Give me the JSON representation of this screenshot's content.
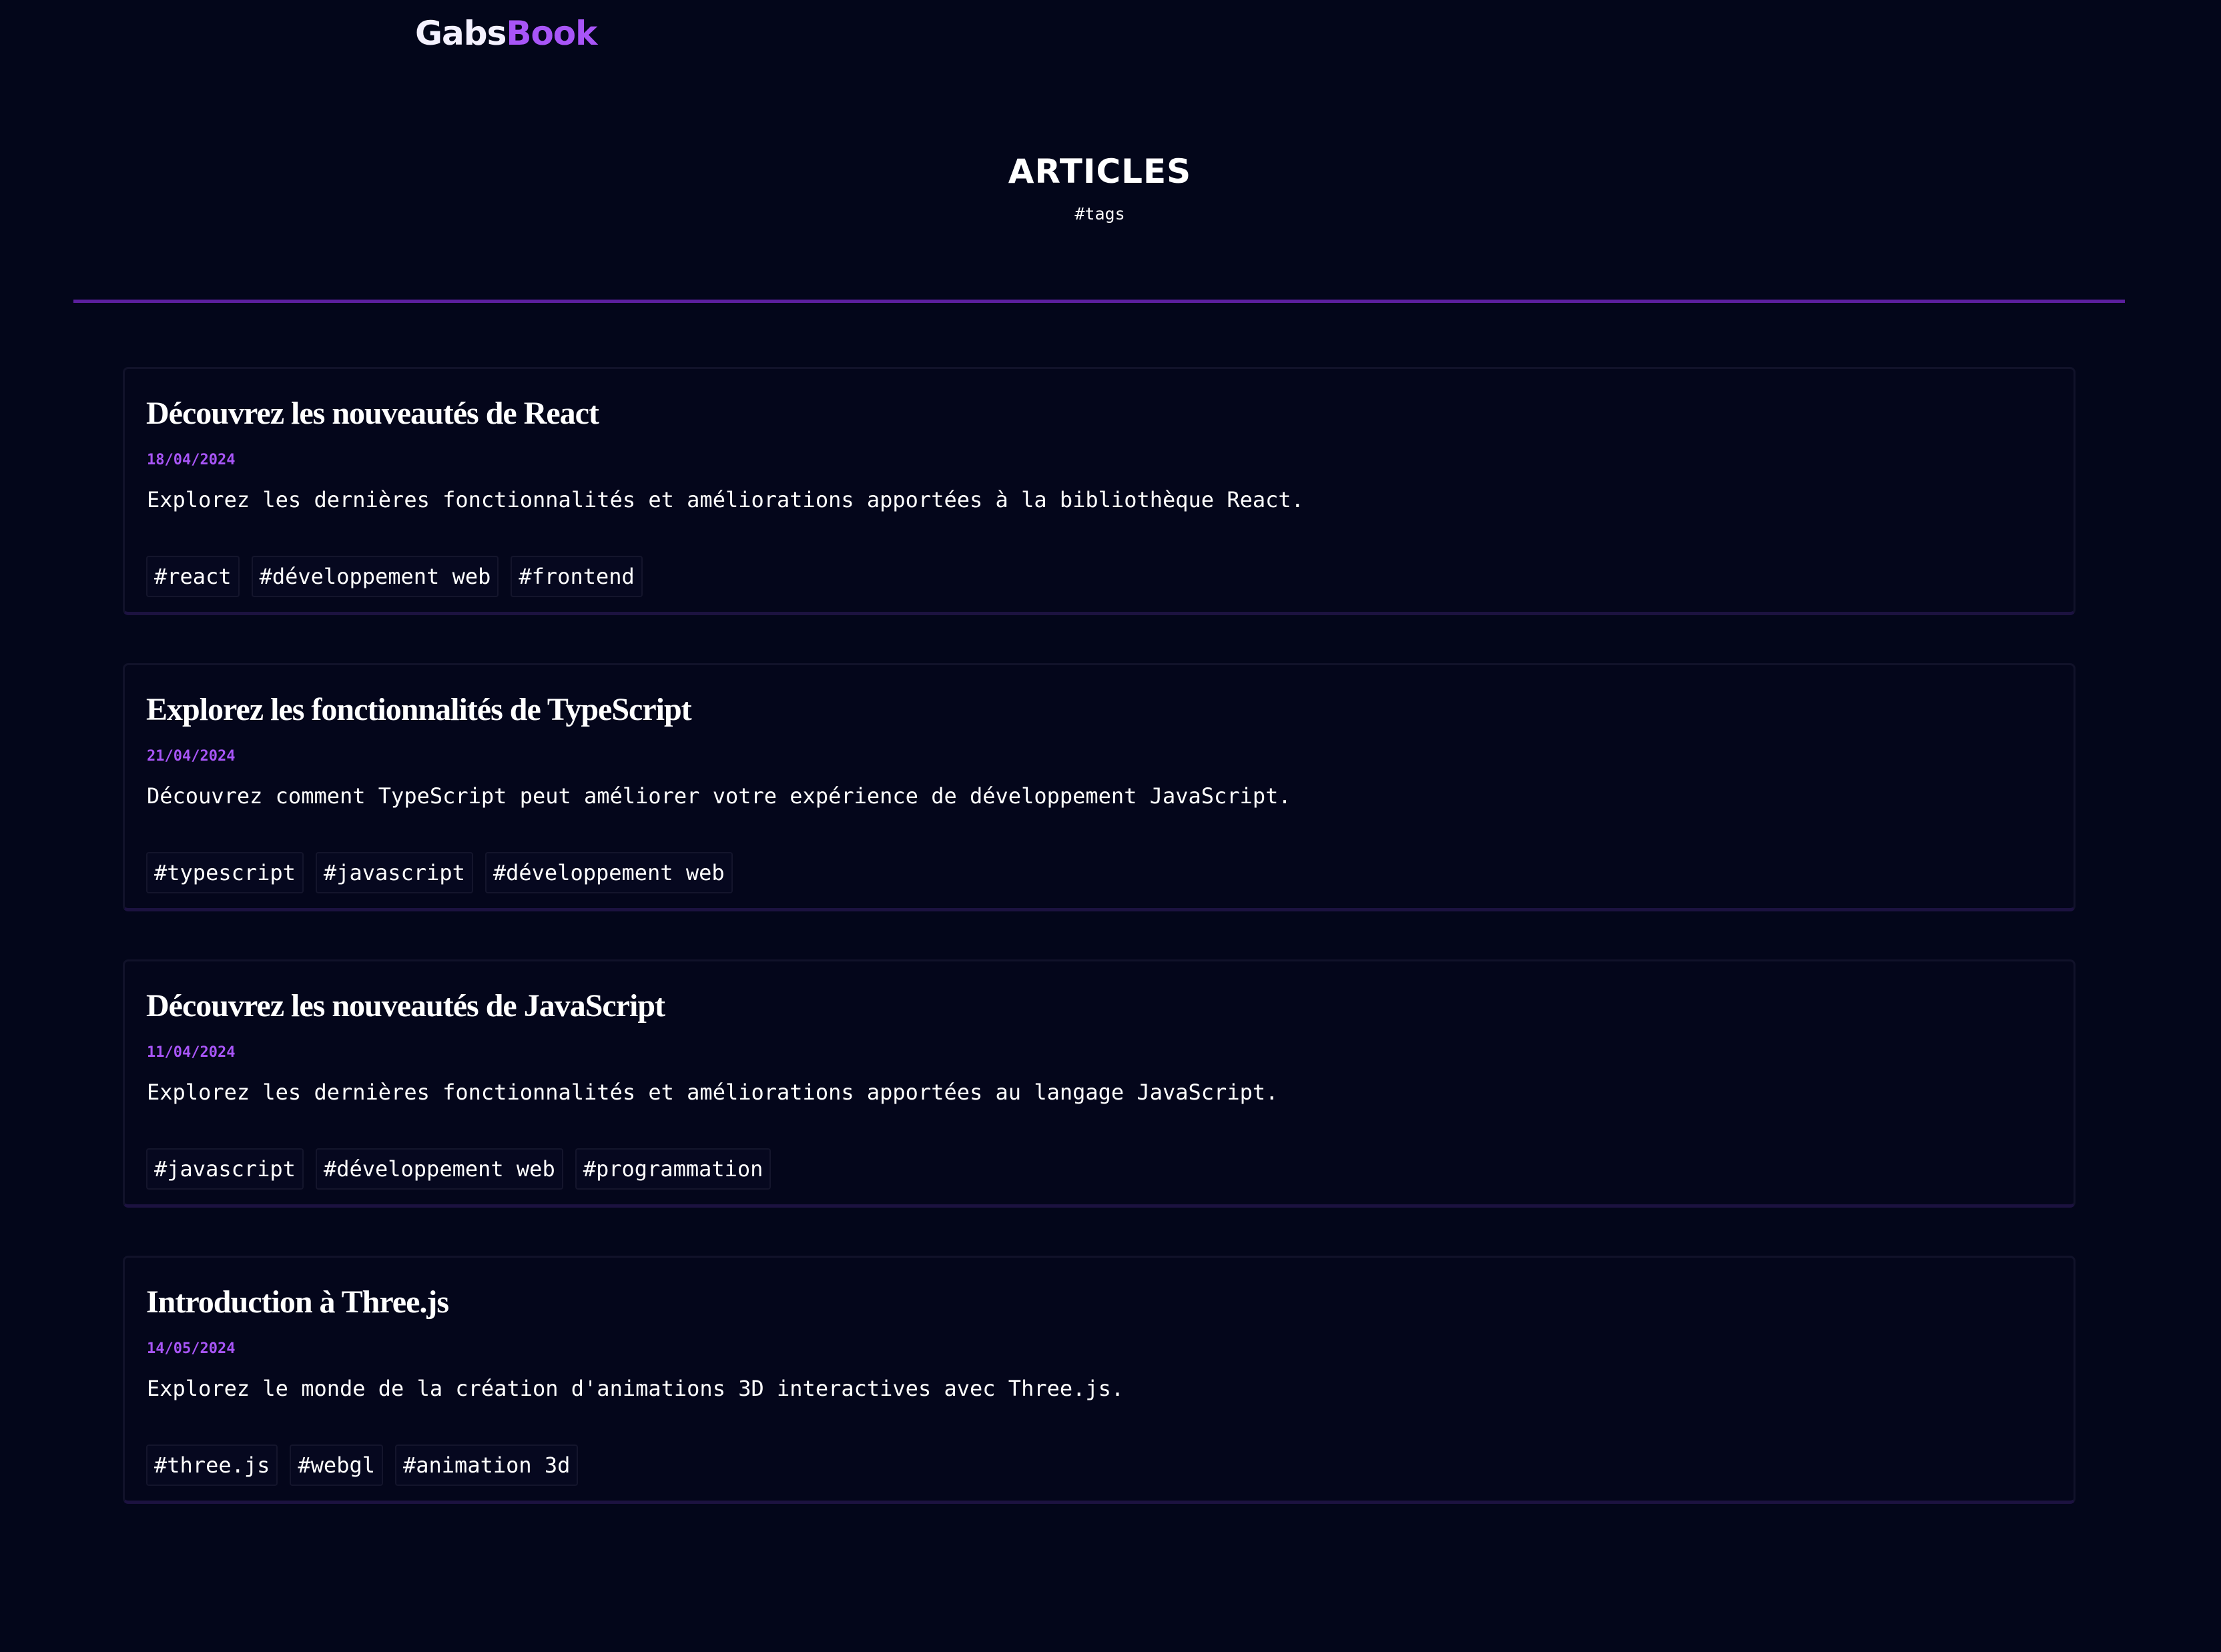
{
  "brand": {
    "part1": "Gabs",
    "part2": "Book"
  },
  "colors": {
    "background": "#03061a",
    "accent": "#a855f7",
    "divider": "#5b1f9e"
  },
  "page": {
    "title": "ARTICLES",
    "tags_link": "#tags"
  },
  "articles": [
    {
      "title": "Découvrez les nouveautés de React",
      "date": "18/04/2024",
      "description": "Explorez les dernières fonctionnalités et améliorations apportées à la bibliothèque React.",
      "tags": [
        "#react",
        "#développement web",
        "#frontend"
      ]
    },
    {
      "title": "Explorez les fonctionnalités de TypeScript",
      "date": "21/04/2024",
      "description": "Découvrez comment TypeScript peut améliorer votre expérience de développement JavaScript.",
      "tags": [
        "#typescript",
        "#javascript",
        "#développement web"
      ]
    },
    {
      "title": "Découvrez les nouveautés de JavaScript",
      "date": "11/04/2024",
      "description": "Explorez les dernières fonctionnalités et améliorations apportées au langage JavaScript.",
      "tags": [
        "#javascript",
        "#développement web",
        "#programmation"
      ]
    },
    {
      "title": "Introduction à Three.js",
      "date": "14/05/2024",
      "description": "Explorez le monde de la création d'animations 3D interactives avec Three.js.",
      "tags": [
        "#three.js",
        "#webgl",
        "#animation 3d"
      ]
    }
  ]
}
